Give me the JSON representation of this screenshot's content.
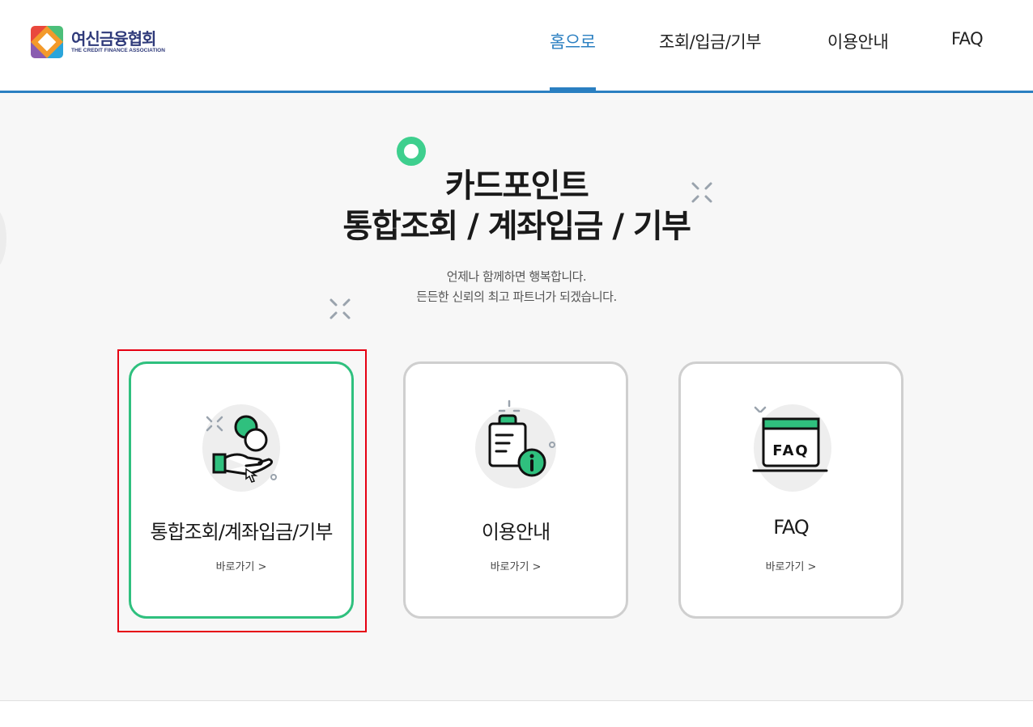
{
  "brand": {
    "name": "여신금융협회",
    "subtitle": "THE CREDIT FINANCE ASSOCIATION"
  },
  "nav": {
    "items": [
      {
        "label": "홈으로",
        "active": true
      },
      {
        "label": "조회/입금/기부",
        "active": false
      },
      {
        "label": "이용안내",
        "active": false
      },
      {
        "label": "FAQ",
        "active": false
      }
    ]
  },
  "hero": {
    "title_line1": "카드포인트",
    "title_line2": "통합조회 / 계좌입금 / 기부",
    "subtitle_line1": "언제나 함께하면 행복합니다.",
    "subtitle_line2": "든든한 신뢰의 최고 파트너가 되겠습니다."
  },
  "cards": [
    {
      "title": "통합조회/계좌입금/기부",
      "link": "바로가기 >",
      "icon": "hand-coin-icon",
      "active": true
    },
    {
      "title": "이용안내",
      "link": "바로가기 >",
      "icon": "clipboard-info-icon",
      "active": false
    },
    {
      "title": "FAQ",
      "link": "바로가기 >",
      "icon": "faq-window-icon",
      "active": false,
      "icon_text": "FAQ"
    }
  ],
  "colors": {
    "accent_blue": "#2a7fc1",
    "accent_green": "#2fc07e",
    "highlight_red": "#e60012"
  }
}
